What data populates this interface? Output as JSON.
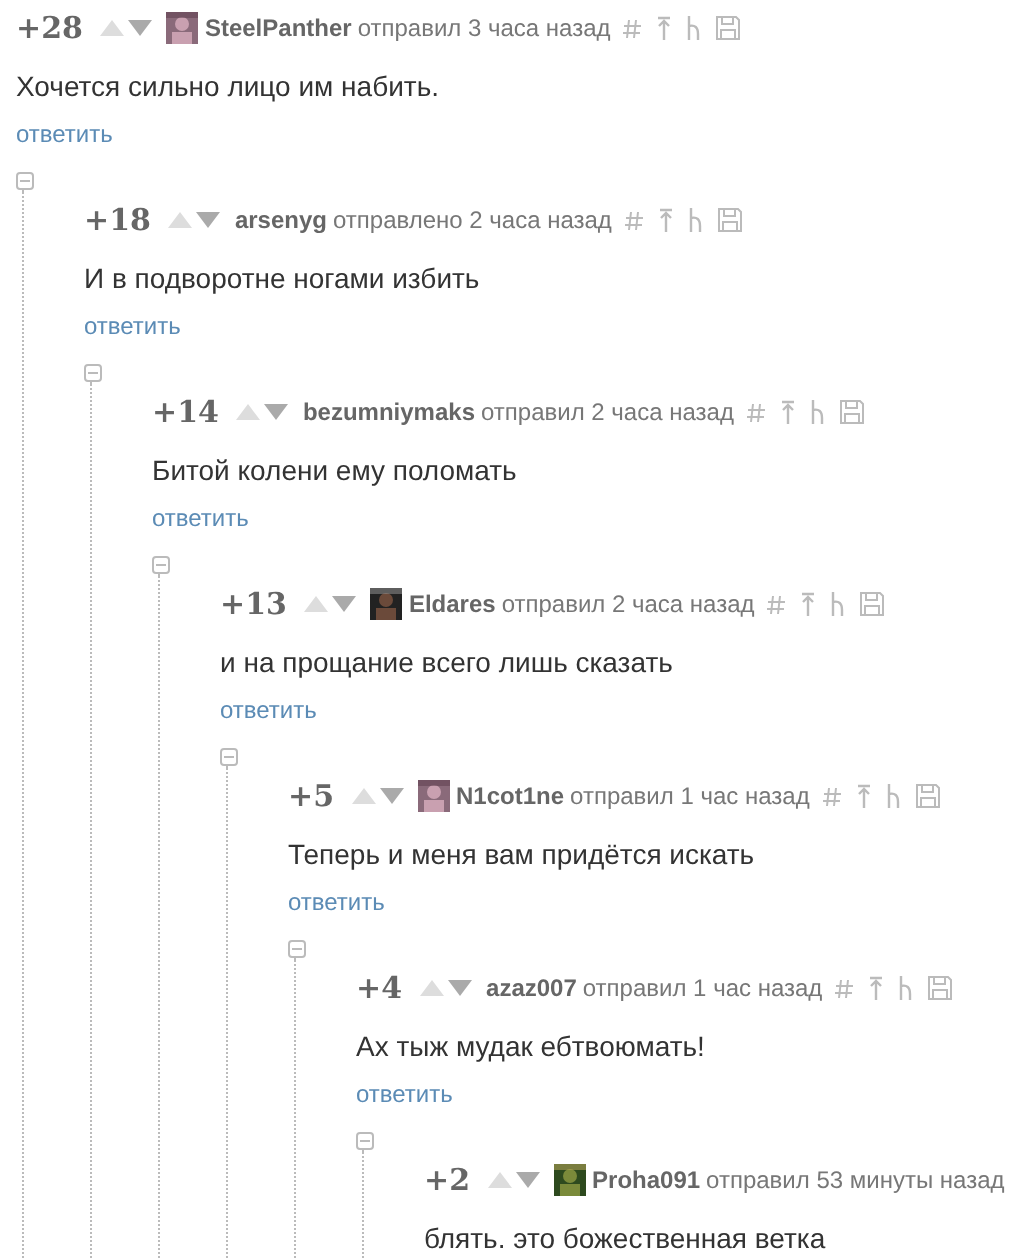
{
  "comment": {
    "score": "+28",
    "avatar": true,
    "user": "SteelPanther",
    "action": "отправил 3 часа назад",
    "tools": true,
    "text": "Хочется сильно лицо им набить.",
    "reply": "ответить",
    "expanded": true,
    "children": [
      {
        "score": "+18",
        "avatar": false,
        "user": "arsenyg",
        "action": "отправлено 2 часа назад",
        "tools": true,
        "text": "И в подворотне ногами избить",
        "reply": "ответить",
        "expanded": true,
        "children": [
          {
            "score": "+14",
            "avatar": false,
            "user": "bezumniymaks",
            "action": "отправил 2 часа назад",
            "tools": true,
            "text": "Битой колени ему поломать",
            "reply": "ответить",
            "expanded": true,
            "children": [
              {
                "score": "+13",
                "avatar": true,
                "user": "Eldares",
                "action": "отправил 2 часа назад",
                "tools": true,
                "text": "и на прощание всего лишь сказать",
                "reply": "ответить",
                "expanded": true,
                "children": [
                  {
                    "score": "+5",
                    "avatar": true,
                    "user": "N1cot1ne",
                    "action": "отправил 1 час назад",
                    "tools": true,
                    "text": "Теперь и меня вам придётся искать",
                    "reply": "ответить",
                    "expanded": true,
                    "children": [
                      {
                        "score": "+4",
                        "avatar": false,
                        "user": "azaz007",
                        "action": "отправил 1 час назад",
                        "tools": true,
                        "text": "Ах тыж мудак ебтвоюмать!",
                        "reply": "ответить",
                        "expanded": true,
                        "children": [
                          {
                            "score": "+2",
                            "avatar": true,
                            "user": "Proha091",
                            "action": "отправил 53 минуты назад",
                            "tools": false,
                            "text": "блять. это божественная ветка"
                          }
                        ]
                      }
                    ]
                  }
                ]
              }
            ]
          }
        ]
      }
    ]
  }
}
